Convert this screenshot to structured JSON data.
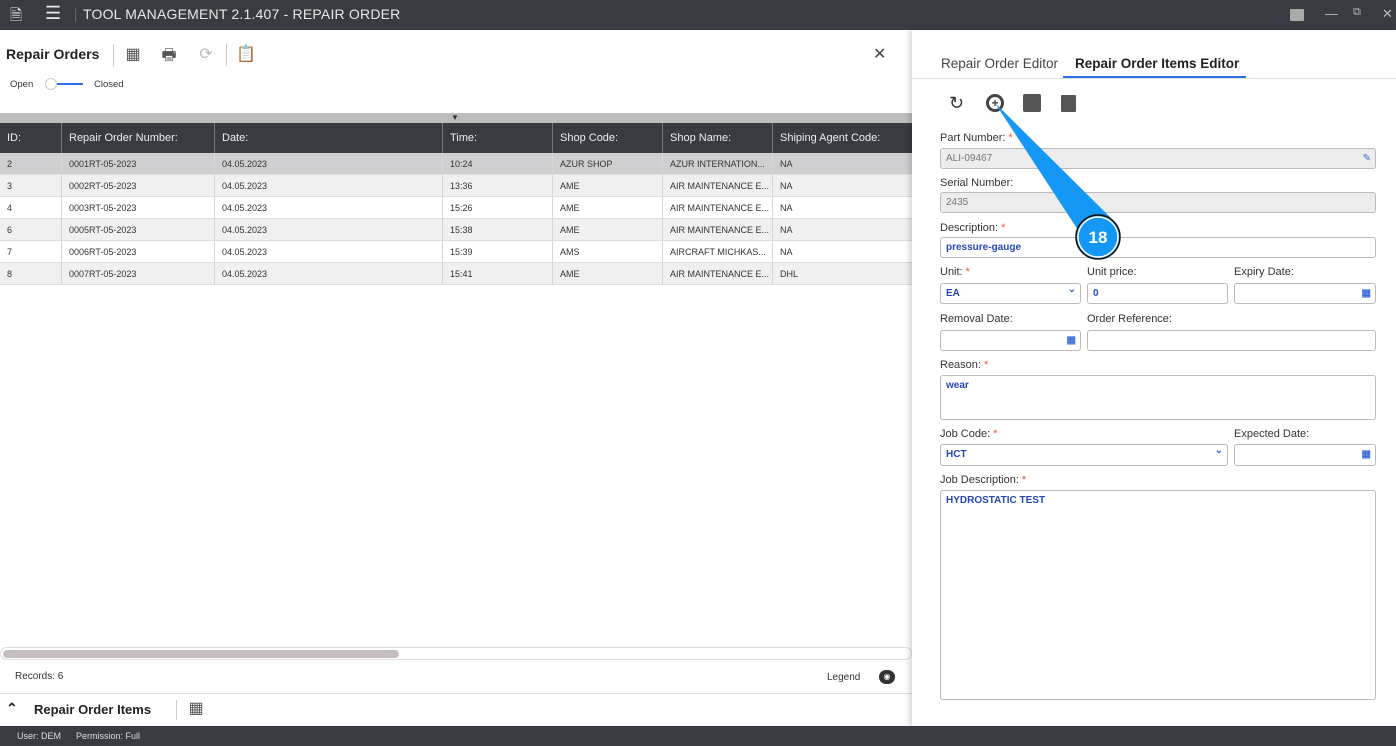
{
  "app": {
    "title": "TOOL MANAGEMENT 2.1.407 - REPAIR ORDER"
  },
  "left": {
    "title": "Repair Orders",
    "toggle": {
      "left": "Open",
      "right": "Closed"
    },
    "columns": [
      "ID:",
      "Repair Order Number:",
      "Date:",
      "Time:",
      "Shop Code:",
      "Shop Name:",
      "Shiping Agent Code:"
    ],
    "rows": [
      [
        "2",
        "0001RT-05-2023",
        "04.05.2023",
        "10:24",
        "AZUR SHOP",
        "AZUR INTERNATION...",
        "NA"
      ],
      [
        "3",
        "0002RT-05-2023",
        "04.05.2023",
        "13:36",
        "AME",
        "AIR MAINTENANCE E...",
        "NA"
      ],
      [
        "4",
        "0003RT-05-2023",
        "04.05.2023",
        "15:26",
        "AME",
        "AIR MAINTENANCE E...",
        "NA"
      ],
      [
        "6",
        "0005RT-05-2023",
        "04.05.2023",
        "15:38",
        "AME",
        "AIR MAINTENANCE E...",
        "NA"
      ],
      [
        "7",
        "0006RT-05-2023",
        "04.05.2023",
        "15:39",
        "AMS",
        "AIRCRAFT MICHKAS...",
        "NA"
      ],
      [
        "8",
        "0007RT-05-2023",
        "04.05.2023",
        "15:41",
        "AME",
        "AIR MAINTENANCE E...",
        "DHL"
      ]
    ],
    "records": "Records: 6",
    "legend": "Legend",
    "items_section": "Repair Order Items"
  },
  "right": {
    "tabs": [
      "Repair Order Editor",
      "Repair Order Items Editor"
    ],
    "fields": {
      "part_number": {
        "label": "Part Number:",
        "value": "ALI-09467"
      },
      "serial_number": {
        "label": "Serial Number:",
        "value": "2435"
      },
      "description": {
        "label": "Description:",
        "value": "pressure-gauge"
      },
      "unit": {
        "label": "Unit:",
        "value": "EA"
      },
      "unit_price": {
        "label": "Unit price:",
        "value": "0"
      },
      "expiry_date": {
        "label": "Expiry Date:",
        "value": ""
      },
      "removal_date": {
        "label": "Removal Date:",
        "value": ""
      },
      "order_reference": {
        "label": "Order Reference:",
        "value": ""
      },
      "reason": {
        "label": "Reason:",
        "value": "wear"
      },
      "job_code": {
        "label": "Job Code:",
        "value": "HCT"
      },
      "expected_date": {
        "label": "Expected Date:",
        "value": ""
      },
      "job_description": {
        "label": "Job Description:",
        "value": "HYDROSTATIC TEST"
      }
    },
    "required_mark": "*"
  },
  "callout": {
    "number": "18",
    "color": "#1597f5"
  },
  "status": {
    "user": "User: DEM",
    "permission": "Permission: Full"
  }
}
